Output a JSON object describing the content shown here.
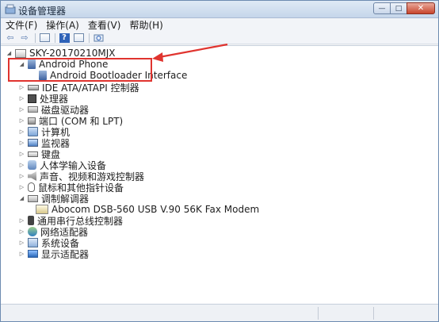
{
  "window": {
    "title": "设备管理器",
    "controls": {
      "minimize": "—",
      "maximize": "□",
      "close": "✕"
    }
  },
  "menu": [
    {
      "label": "文件(F)"
    },
    {
      "label": "操作(A)"
    },
    {
      "label": "查看(V)"
    },
    {
      "label": "帮助(H)"
    }
  ],
  "toolbar": {
    "back": "⇦",
    "forward": "⇨",
    "help": "?"
  },
  "tree": {
    "root": "SKY-20170210MJX",
    "android_phone": "Android Phone",
    "android_bootloader": "Android Bootloader Interface",
    "ide": "IDE ATA/ATAPI 控制器",
    "processor": "处理器",
    "disk": "磁盘驱动器",
    "ports": "端口 (COM 和 LPT)",
    "computer": "计算机",
    "monitor": "监视器",
    "keyboard": "键盘",
    "hid": "人体学输入设备",
    "audio": "声音、视频和游戏控制器",
    "mouse": "鼠标和其他指针设备",
    "modem": "调制解调器",
    "modem_child": "Abocom DSB-560 USB V.90 56K Fax Modem",
    "usb": "通用串行总线控制器",
    "network": "网络适配器",
    "system": "系统设备",
    "display": "显示适配器"
  },
  "annotation": {
    "highlight_color": "#e0342f"
  }
}
